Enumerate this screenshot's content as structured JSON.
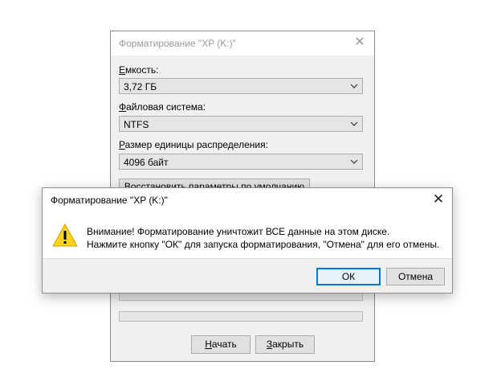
{
  "format_dialog": {
    "title": "Форматирование \"XP (K:)\"",
    "close_glyph": "✕",
    "capacity": {
      "label_accel": "Е",
      "label_rest": "мкость:",
      "value": "3,72 ГБ"
    },
    "filesystem": {
      "label_accel": "Ф",
      "label_rest": "айловая система:",
      "value": "NTFS"
    },
    "allocation": {
      "label_accel": "Р",
      "label_rest": "азмер единицы распределения:",
      "value": "4096 байт"
    },
    "restore_defaults_label": "Восстановить параметры по умолчанию",
    "start": {
      "accel": "Н",
      "rest": "ачать"
    },
    "close": {
      "accel": "З",
      "rest": "акрыть"
    }
  },
  "warning_dialog": {
    "title": "Форматирование \"XP (K:)\"",
    "close_glyph": "✕",
    "icon": "warning-icon",
    "message_line1": "Внимание! Форматирование уничтожит ВСЕ данные на этом диске.",
    "message_line2": "Нажмите кнопку \"ОК\" для запуска форматирования, \"Отмена\" для его отмены.",
    "ok_label": "ОК",
    "cancel_label": "Отмена"
  },
  "colors": {
    "accent_focus": "#0078d7",
    "warning_yellow": "#ffd21f"
  }
}
